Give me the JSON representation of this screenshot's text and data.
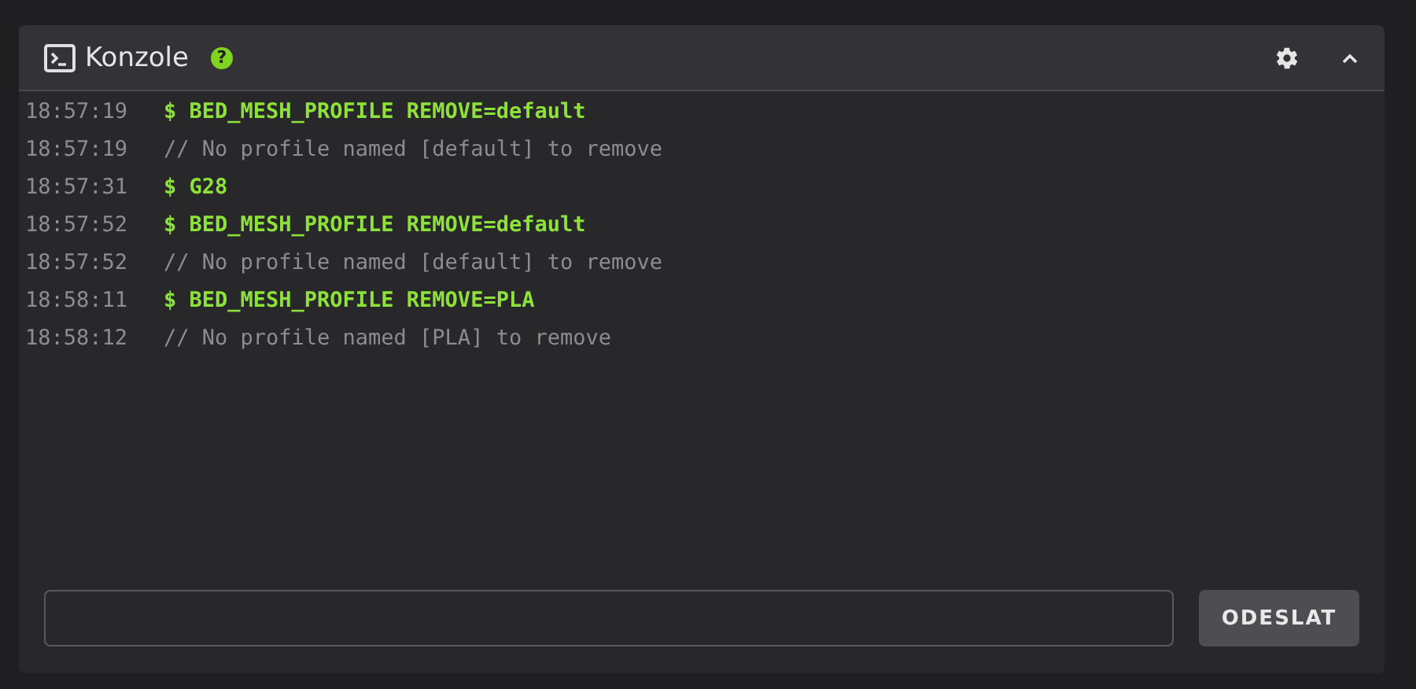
{
  "panel": {
    "title": "Konzole",
    "help_icon": "?"
  },
  "lines": [
    {
      "time": "18:57:19",
      "kind": "command",
      "text": "$ BED_MESH_PROFILE REMOVE=default"
    },
    {
      "time": "18:57:19",
      "kind": "response",
      "text": "// No profile named [default] to remove"
    },
    {
      "time": "18:57:31",
      "kind": "command",
      "text": "$ G28"
    },
    {
      "time": "18:57:52",
      "kind": "command",
      "text": "$ BED_MESH_PROFILE REMOVE=default"
    },
    {
      "time": "18:57:52",
      "kind": "response",
      "text": "// No profile named [default] to remove"
    },
    {
      "time": "18:58:11",
      "kind": "command",
      "text": "$ BED_MESH_PROFILE REMOVE=PLA"
    },
    {
      "time": "18:58:12",
      "kind": "response",
      "text": "// No profile named [PLA] to remove"
    }
  ],
  "send_button": "ODESLAT"
}
